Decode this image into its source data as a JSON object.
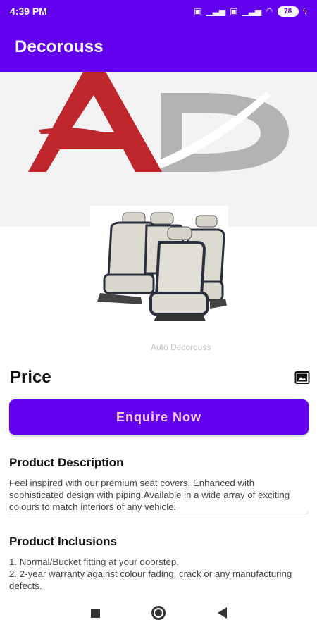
{
  "status_bar": {
    "time": "4:39 PM",
    "battery": "78",
    "icons": [
      "volte-icon",
      "signal-icon",
      "volte-icon",
      "signal-icon",
      "wifi-icon",
      "battery-icon",
      "charging-icon"
    ]
  },
  "app_bar": {
    "title": "Decorouss"
  },
  "hero": {
    "logo_letters": "AD",
    "watermark": "Auto Decorouss"
  },
  "product": {
    "price_label": "Price",
    "enquire_label": "Enquire Now"
  },
  "description": {
    "title": "Product Description",
    "text": "Feel inspired with our premium seat covers. Enhanced with sophisticated design with piping.Available in a wide array of exciting colours to match interiors of any vehicle."
  },
  "inclusions": {
    "title": "Product Inclusions",
    "line1": "1. Normal/Bucket fitting at your doorstep.",
    "line2": "2. 2-year warranty against colour fading, crack or any manufacturing defects."
  },
  "colors": {
    "primary": "#6200ee",
    "button_text": "#f6c9d7",
    "logo_red": "#c0272d",
    "logo_grey": "#b3b3b3"
  }
}
